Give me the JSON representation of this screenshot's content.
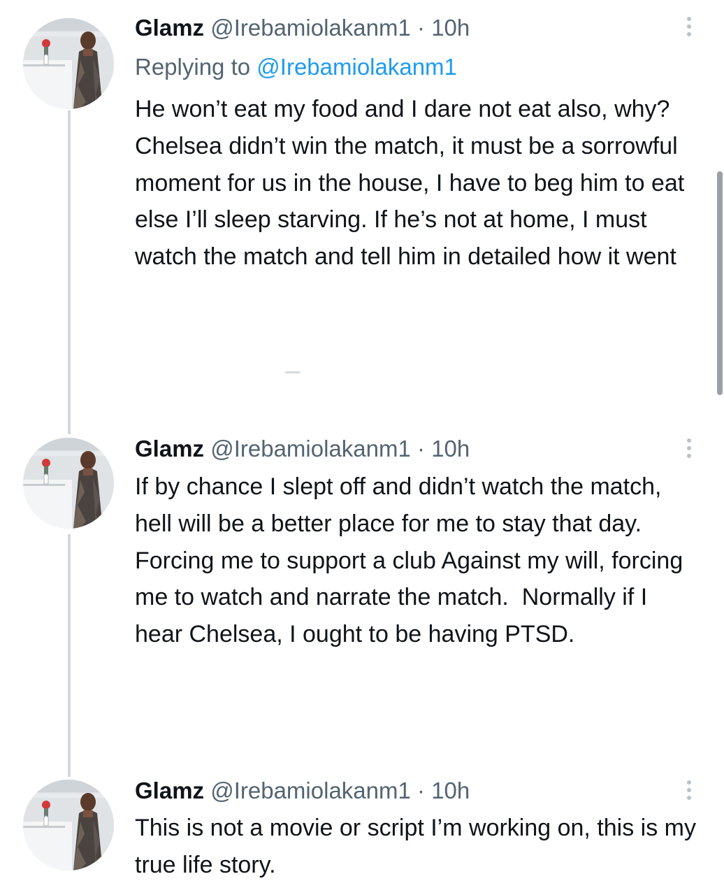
{
  "tweets": [
    {
      "name": "Glamz",
      "handle": "@Irebamiolakanm1",
      "separator": "·",
      "time": "10h",
      "replying_prefix": "Replying to",
      "replying_to": "@Irebamiolakanm1",
      "text": "He won’t eat my food and I dare not eat also, why? Chelsea didn’t win the match, it must be a sorrowful moment for us in the house, I have to beg him to eat else I’ll sleep starving. If he’s not at home, I must watch the match and tell him in detailed how it went"
    },
    {
      "name": "Glamz",
      "handle": "@Irebamiolakanm1",
      "separator": "·",
      "time": "10h",
      "text": "If by chance I slept off and didn’t watch the match, hell will be a better place for me to stay that day. Forcing me to support a club Against my will, forcing me to watch and narrate the match.  Normally if I hear Chelsea, I ought to be having PTSD."
    },
    {
      "name": "Glamz",
      "handle": "@Irebamiolakanm1",
      "separator": "·",
      "time": "10h",
      "text": "This is not a movie or script I’m working on, this is my true life story."
    }
  ],
  "colors": {
    "text": "#0f1419",
    "secondary": "#536471",
    "link": "#1d9bf0",
    "thread_line": "#cfd9de"
  },
  "icons": {
    "more": "more-vertical-icon",
    "avatar": "profile-avatar"
  }
}
